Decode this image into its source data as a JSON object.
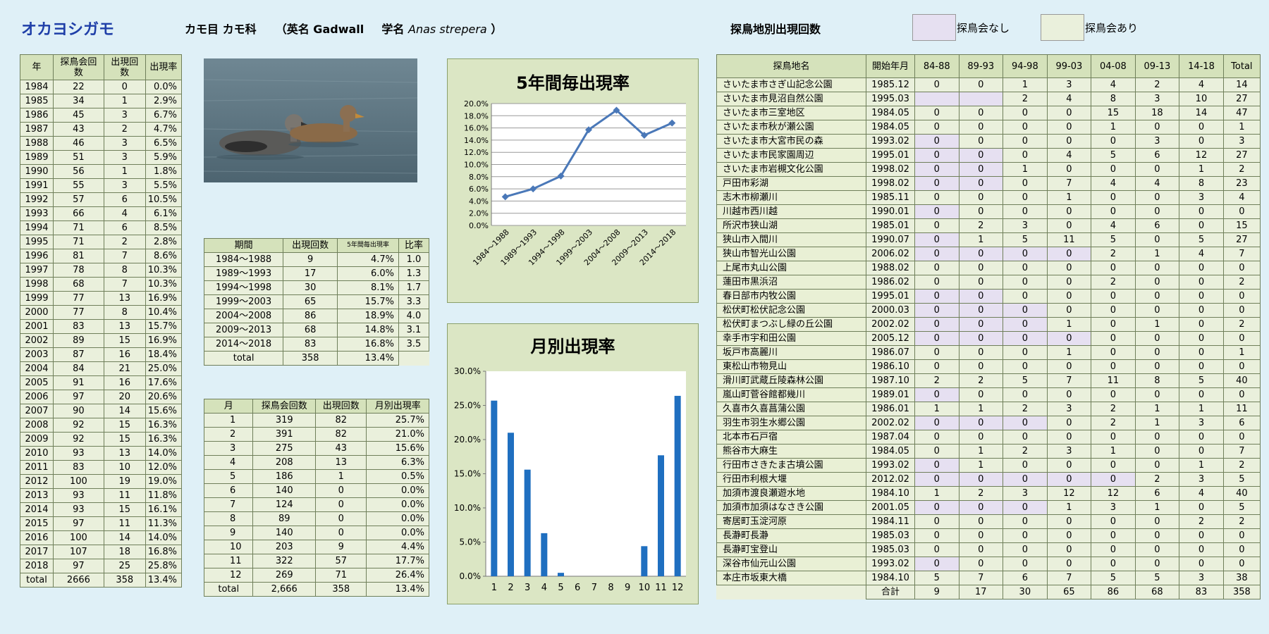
{
  "header": {
    "title": "オカヨシガモ",
    "classification": "カモ目 カモ科",
    "english_prefix": "（英名 Gadwall",
    "sci_prefix": "学名",
    "sci_name": "Anas strepera",
    "sci_suffix": "）",
    "site_title": "探鳥地別出現回数",
    "legend_none": "探鳥会なし",
    "legend_has": "探鳥会あり"
  },
  "colors": {
    "none_bg": "#e6e0f1",
    "has_bg": "#eaf0dc",
    "bar": "#1f6fc0",
    "line": "#4a78b8",
    "title": "#1f3fa8"
  },
  "photo": {
    "alt": "Gadwall ducks on water"
  },
  "yearly": {
    "headers": [
      "年",
      "探鳥会回数",
      "出現回数",
      "出現率"
    ],
    "rows": [
      [
        "1984",
        "22",
        "0",
        "0.0%"
      ],
      [
        "1985",
        "34",
        "1",
        "2.9%"
      ],
      [
        "1986",
        "45",
        "3",
        "6.7%"
      ],
      [
        "1987",
        "43",
        "2",
        "4.7%"
      ],
      [
        "1988",
        "46",
        "3",
        "6.5%"
      ],
      [
        "1989",
        "51",
        "3",
        "5.9%"
      ],
      [
        "1990",
        "56",
        "1",
        "1.8%"
      ],
      [
        "1991",
        "55",
        "3",
        "5.5%"
      ],
      [
        "1992",
        "57",
        "6",
        "10.5%"
      ],
      [
        "1993",
        "66",
        "4",
        "6.1%"
      ],
      [
        "1994",
        "71",
        "6",
        "8.5%"
      ],
      [
        "1995",
        "71",
        "2",
        "2.8%"
      ],
      [
        "1996",
        "81",
        "7",
        "8.6%"
      ],
      [
        "1997",
        "78",
        "8",
        "10.3%"
      ],
      [
        "1998",
        "68",
        "7",
        "10.3%"
      ],
      [
        "1999",
        "77",
        "13",
        "16.9%"
      ],
      [
        "2000",
        "77",
        "8",
        "10.4%"
      ],
      [
        "2001",
        "83",
        "13",
        "15.7%"
      ],
      [
        "2002",
        "89",
        "15",
        "16.9%"
      ],
      [
        "2003",
        "87",
        "16",
        "18.4%"
      ],
      [
        "2004",
        "84",
        "21",
        "25.0%"
      ],
      [
        "2005",
        "91",
        "16",
        "17.6%"
      ],
      [
        "2006",
        "97",
        "20",
        "20.6%"
      ],
      [
        "2007",
        "90",
        "14",
        "15.6%"
      ],
      [
        "2008",
        "92",
        "15",
        "16.3%"
      ],
      [
        "2009",
        "92",
        "15",
        "16.3%"
      ],
      [
        "2010",
        "93",
        "13",
        "14.0%"
      ],
      [
        "2011",
        "83",
        "10",
        "12.0%"
      ],
      [
        "2012",
        "100",
        "19",
        "19.0%"
      ],
      [
        "2013",
        "93",
        "11",
        "11.8%"
      ],
      [
        "2014",
        "93",
        "15",
        "16.1%"
      ],
      [
        "2015",
        "97",
        "11",
        "11.3%"
      ],
      [
        "2016",
        "100",
        "14",
        "14.0%"
      ],
      [
        "2017",
        "107",
        "18",
        "16.8%"
      ],
      [
        "2018",
        "97",
        "25",
        "25.8%"
      ],
      [
        "total",
        "2666",
        "358",
        "13.4%"
      ]
    ]
  },
  "period": {
    "headers": [
      "期間",
      "出現回数",
      "5年間毎出現率",
      "比率"
    ],
    "rows": [
      [
        "1984～1988",
        "9",
        "4.7%",
        "1.0"
      ],
      [
        "1989～1993",
        "17",
        "6.0%",
        "1.3"
      ],
      [
        "1994～1998",
        "30",
        "8.1%",
        "1.7"
      ],
      [
        "1999～2003",
        "65",
        "15.7%",
        "3.3"
      ],
      [
        "2004～2008",
        "86",
        "18.9%",
        "4.0"
      ],
      [
        "2009～2013",
        "68",
        "14.8%",
        "3.1"
      ],
      [
        "2014～2018",
        "83",
        "16.8%",
        "3.5"
      ]
    ],
    "total_row": [
      "total",
      "358",
      "13.4%"
    ]
  },
  "monthly": {
    "headers": [
      "月",
      "探鳥会回数",
      "出現回数",
      "月別出現率"
    ],
    "rows": [
      [
        "1",
        "319",
        "82",
        "25.7%"
      ],
      [
        "2",
        "391",
        "82",
        "21.0%"
      ],
      [
        "3",
        "275",
        "43",
        "15.6%"
      ],
      [
        "4",
        "208",
        "13",
        "6.3%"
      ],
      [
        "5",
        "186",
        "1",
        "0.5%"
      ],
      [
        "6",
        "140",
        "0",
        "0.0%"
      ],
      [
        "7",
        "124",
        "0",
        "0.0%"
      ],
      [
        "8",
        "89",
        "0",
        "0.0%"
      ],
      [
        "9",
        "140",
        "0",
        "0.0%"
      ],
      [
        "10",
        "203",
        "9",
        "4.4%"
      ],
      [
        "11",
        "322",
        "57",
        "17.7%"
      ],
      [
        "12",
        "269",
        "71",
        "26.4%"
      ],
      [
        "total",
        "2,666",
        "358",
        "13.4%"
      ]
    ]
  },
  "chart_data": [
    {
      "type": "line",
      "title": "5年間毎出現率",
      "categories": [
        "1984～1988",
        "1989～1993",
        "1994～1998",
        "1999～2003",
        "2004～2008",
        "2009～2013",
        "2014～2018"
      ],
      "values": [
        4.7,
        6.0,
        8.1,
        15.7,
        18.9,
        14.8,
        16.8
      ],
      "ylim": [
        0,
        20
      ],
      "yticks": [
        "0.0%",
        "2.0%",
        "4.0%",
        "6.0%",
        "8.0%",
        "10.0%",
        "12.0%",
        "14.0%",
        "16.0%",
        "18.0%",
        "20.0%"
      ],
      "grid": true
    },
    {
      "type": "bar",
      "title": "月別出現率",
      "categories": [
        "1",
        "2",
        "3",
        "4",
        "5",
        "6",
        "7",
        "8",
        "9",
        "10",
        "11",
        "12"
      ],
      "values": [
        25.7,
        21.0,
        15.6,
        6.3,
        0.5,
        0,
        0,
        0,
        0,
        4.4,
        17.7,
        26.4
      ],
      "ylim": [
        0,
        30
      ],
      "yticks": [
        "0.0%",
        "5.0%",
        "10.0%",
        "15.0%",
        "20.0%",
        "25.0%",
        "30.0%"
      ],
      "grid": false
    }
  ],
  "sites": {
    "headers": [
      "探鳥地名",
      "開始年月",
      "84-88",
      "89-93",
      "94-98",
      "99-03",
      "04-08",
      "09-13",
      "14-18",
      "Total"
    ],
    "rows": [
      {
        "name": "さいたま市さぎ山記念公園",
        "start": "1985.12",
        "v": [
          "0",
          "0",
          "1",
          "3",
          "4",
          "2",
          "4",
          "14"
        ],
        "none": []
      },
      {
        "name": "さいたま市見沼自然公園",
        "start": "1995.03",
        "v": [
          "",
          "",
          "2",
          "4",
          "8",
          "3",
          "10",
          "27"
        ],
        "none": [
          0,
          1
        ]
      },
      {
        "name": "さいたま市三室地区",
        "start": "1984.05",
        "v": [
          "0",
          "0",
          "0",
          "0",
          "15",
          "18",
          "14",
          "47"
        ],
        "none": []
      },
      {
        "name": "さいたま市秋が瀬公園",
        "start": "1984.05",
        "v": [
          "0",
          "0",
          "0",
          "0",
          "1",
          "0",
          "0",
          "1"
        ],
        "none": []
      },
      {
        "name": "さいたま市大宮市民の森",
        "start": "1993.02",
        "v": [
          "0",
          "0",
          "0",
          "0",
          "0",
          "3",
          "0",
          "3"
        ],
        "none": [
          0
        ]
      },
      {
        "name": "さいたま市民家園周辺",
        "start": "1995.01",
        "v": [
          "0",
          "0",
          "0",
          "4",
          "5",
          "6",
          "12",
          "27"
        ],
        "none": [
          0,
          1
        ]
      },
      {
        "name": "さいたま市岩槻文化公園",
        "start": "1998.02",
        "v": [
          "0",
          "0",
          "1",
          "0",
          "0",
          "0",
          "1",
          "2"
        ],
        "none": [
          0,
          1
        ]
      },
      {
        "name": "戸田市彩湖",
        "start": "1998.02",
        "v": [
          "0",
          "0",
          "0",
          "7",
          "4",
          "4",
          "8",
          "23"
        ],
        "none": [
          0,
          1
        ]
      },
      {
        "name": "志木市柳瀬川",
        "start": "1985.11",
        "v": [
          "0",
          "0",
          "0",
          "1",
          "0",
          "0",
          "3",
          "4"
        ],
        "none": []
      },
      {
        "name": "川越市西川越",
        "start": "1990.01",
        "v": [
          "0",
          "0",
          "0",
          "0",
          "0",
          "0",
          "0",
          "0"
        ],
        "none": [
          0
        ]
      },
      {
        "name": "所沢市狭山湖",
        "start": "1985.01",
        "v": [
          "0",
          "2",
          "3",
          "0",
          "4",
          "6",
          "0",
          "15"
        ],
        "none": []
      },
      {
        "name": "狭山市入間川",
        "start": "1990.07",
        "v": [
          "0",
          "1",
          "5",
          "11",
          "5",
          "0",
          "5",
          "27"
        ],
        "none": [
          0
        ]
      },
      {
        "name": "狭山市智光山公園",
        "start": "2006.02",
        "v": [
          "0",
          "0",
          "0",
          "0",
          "2",
          "1",
          "4",
          "7"
        ],
        "none": [
          0,
          1,
          2,
          3
        ]
      },
      {
        "name": "上尾市丸山公園",
        "start": "1988.02",
        "v": [
          "0",
          "0",
          "0",
          "0",
          "0",
          "0",
          "0",
          "0"
        ],
        "none": []
      },
      {
        "name": "蓮田市黒浜沼",
        "start": "1986.02",
        "v": [
          "0",
          "0",
          "0",
          "0",
          "2",
          "0",
          "0",
          "2"
        ],
        "none": []
      },
      {
        "name": "春日部市内牧公園",
        "start": "1995.01",
        "v": [
          "0",
          "0",
          "0",
          "0",
          "0",
          "0",
          "0",
          "0"
        ],
        "none": [
          0,
          1
        ]
      },
      {
        "name": "松伏町松伏記念公園",
        "start": "2000.03",
        "v": [
          "0",
          "0",
          "0",
          "0",
          "0",
          "0",
          "0",
          "0"
        ],
        "none": [
          0,
          1,
          2
        ]
      },
      {
        "name": "松伏町まつぶし緑の丘公園",
        "start": "2002.02",
        "v": [
          "0",
          "0",
          "0",
          "1",
          "0",
          "1",
          "0",
          "2"
        ],
        "none": [
          0,
          1,
          2
        ]
      },
      {
        "name": "幸手市宇和田公園",
        "start": "2005.12",
        "v": [
          "0",
          "0",
          "0",
          "0",
          "0",
          "0",
          "0",
          "0"
        ],
        "none": [
          0,
          1,
          2,
          3
        ]
      },
      {
        "name": "坂戸市高麗川",
        "start": "1986.07",
        "v": [
          "0",
          "0",
          "0",
          "1",
          "0",
          "0",
          "0",
          "1"
        ],
        "none": []
      },
      {
        "name": "東松山市物見山",
        "start": "1986.10",
        "v": [
          "0",
          "0",
          "0",
          "0",
          "0",
          "0",
          "0",
          "0"
        ],
        "none": []
      },
      {
        "name": "滑川町武蔵丘陵森林公園",
        "start": "1987.10",
        "v": [
          "2",
          "2",
          "5",
          "7",
          "11",
          "8",
          "5",
          "40"
        ],
        "none": []
      },
      {
        "name": "嵐山町菅谷館都幾川",
        "start": "1989.01",
        "v": [
          "0",
          "0",
          "0",
          "0",
          "0",
          "0",
          "0",
          "0"
        ],
        "none": [
          0
        ]
      },
      {
        "name": "久喜市久喜菖蒲公園",
        "start": "1986.01",
        "v": [
          "1",
          "1",
          "2",
          "3",
          "2",
          "1",
          "1",
          "11"
        ],
        "none": []
      },
      {
        "name": "羽生市羽生水郷公園",
        "start": "2002.02",
        "v": [
          "0",
          "0",
          "0",
          "0",
          "2",
          "1",
          "3",
          "6"
        ],
        "none": [
          0,
          1,
          2
        ]
      },
      {
        "name": "北本市石戸宿",
        "start": "1987.04",
        "v": [
          "0",
          "0",
          "0",
          "0",
          "0",
          "0",
          "0",
          "0"
        ],
        "none": []
      },
      {
        "name": "熊谷市大麻生",
        "start": "1984.05",
        "v": [
          "0",
          "1",
          "2",
          "3",
          "1",
          "0",
          "0",
          "7"
        ],
        "none": []
      },
      {
        "name": "行田市さきたま古墳公園",
        "start": "1993.02",
        "v": [
          "0",
          "1",
          "0",
          "0",
          "0",
          "0",
          "1",
          "2"
        ],
        "none": [
          0
        ]
      },
      {
        "name": "行田市利根大堰",
        "start": "2012.02",
        "v": [
          "0",
          "0",
          "0",
          "0",
          "0",
          "2",
          "3",
          "5"
        ],
        "none": [
          0,
          1,
          2,
          3,
          4
        ]
      },
      {
        "name": "加須市渡良瀬遊水地",
        "start": "1984.10",
        "v": [
          "1",
          "2",
          "3",
          "12",
          "12",
          "6",
          "4",
          "40"
        ],
        "none": []
      },
      {
        "name": "加須市加須はなさき公園",
        "start": "2001.05",
        "v": [
          "0",
          "0",
          "0",
          "1",
          "3",
          "1",
          "0",
          "5"
        ],
        "none": [
          0,
          1,
          2
        ]
      },
      {
        "name": "寄居町玉淀河原",
        "start": "1984.11",
        "v": [
          "0",
          "0",
          "0",
          "0",
          "0",
          "0",
          "2",
          "2"
        ],
        "none": []
      },
      {
        "name": "長瀞町長瀞",
        "start": "1985.03",
        "v": [
          "0",
          "0",
          "0",
          "0",
          "0",
          "0",
          "0",
          "0"
        ],
        "none": []
      },
      {
        "name": "長瀞町宝登山",
        "start": "1985.03",
        "v": [
          "0",
          "0",
          "0",
          "0",
          "0",
          "0",
          "0",
          "0"
        ],
        "none": []
      },
      {
        "name": "深谷市仙元山公園",
        "start": "1993.02",
        "v": [
          "0",
          "0",
          "0",
          "0",
          "0",
          "0",
          "0",
          "0"
        ],
        "none": [
          0
        ]
      },
      {
        "name": "本庄市坂東大橋",
        "start": "1984.10",
        "v": [
          "5",
          "7",
          "6",
          "7",
          "5",
          "5",
          "3",
          "38"
        ],
        "none": []
      }
    ],
    "total_label": "合計",
    "totals": [
      "9",
      "17",
      "30",
      "65",
      "86",
      "68",
      "83",
      "358"
    ]
  }
}
